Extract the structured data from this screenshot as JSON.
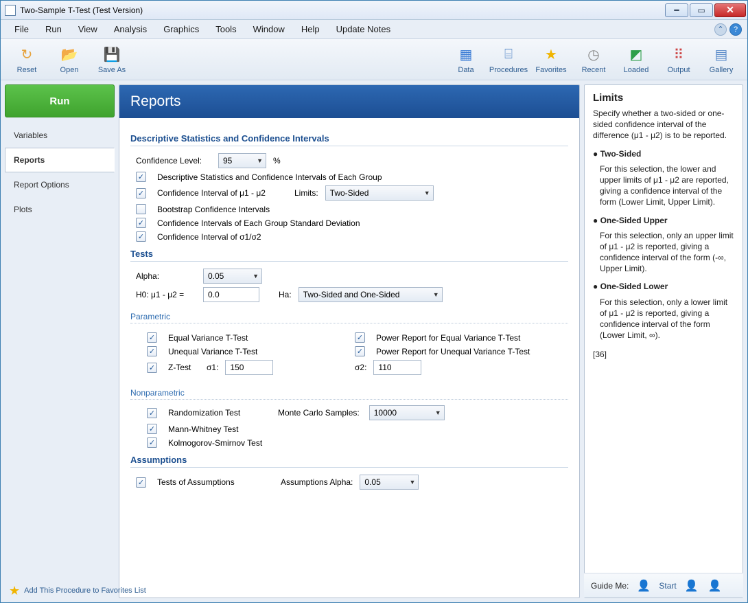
{
  "window": {
    "title": "Two-Sample T-Test (Test Version)"
  },
  "menubar": [
    "File",
    "Run",
    "View",
    "Analysis",
    "Graphics",
    "Tools",
    "Window",
    "Help",
    "Update Notes"
  ],
  "toolbar_left": [
    {
      "label": "Reset",
      "glyph": "↻",
      "color": "#e6a23c"
    },
    {
      "label": "Open",
      "glyph": "📂",
      "color": "#e6a23c"
    },
    {
      "label": "Save As",
      "glyph": "💾",
      "color": "#5b8bc9"
    }
  ],
  "toolbar_right": [
    {
      "label": "Data",
      "glyph": "▦",
      "color": "#3a7bd5"
    },
    {
      "label": "Procedures",
      "glyph": "⌸",
      "color": "#5b8bc9"
    },
    {
      "label": "Favorites",
      "glyph": "★",
      "color": "#f0b400"
    },
    {
      "label": "Recent",
      "glyph": "◷",
      "color": "#888"
    },
    {
      "label": "Loaded",
      "glyph": "◩",
      "color": "#2e9e4a"
    },
    {
      "label": "Output",
      "glyph": "⠿",
      "color": "#c44"
    },
    {
      "label": "Gallery",
      "glyph": "▤",
      "color": "#5b8bc9"
    }
  ],
  "run_label": "Run",
  "navtabs": [
    "Variables",
    "Reports",
    "Report Options",
    "Plots"
  ],
  "active_nav": 1,
  "banner": "Reports",
  "sections": {
    "descriptive_title": "Descriptive Statistics and Confidence Intervals",
    "tests_title": "Tests",
    "parametric_title": "Parametric",
    "nonparametric_title": "Nonparametric",
    "assumptions_title": "Assumptions"
  },
  "fields": {
    "confidence_level_label": "Confidence Level:",
    "confidence_level_value": "95",
    "confidence_level_suffix": "%",
    "chk_desc_stats": "Descriptive Statistics and Confidence Intervals of Each Group",
    "chk_ci_mu": "Confidence Interval of μ1 - μ2",
    "limits_label": "Limits:",
    "limits_value": "Two-Sided",
    "chk_bootstrap": "Bootstrap Confidence Intervals",
    "chk_ci_group_sd": "Confidence Intervals of Each Group Standard Deviation",
    "chk_ci_sigma_ratio": "Confidence Interval of σ1/σ2",
    "alpha_label": "Alpha:",
    "alpha_value": "0.05",
    "h0_label": "H0: μ1 - μ2 =",
    "h0_value": "0.0",
    "ha_label": "Ha:",
    "ha_value": "Two-Sided and One-Sided",
    "chk_eqvar": "Equal Variance T-Test",
    "chk_uneqvar": "Unequal Variance T-Test",
    "chk_ztest": "Z-Test",
    "sigma1_label": "σ1:",
    "sigma1_value": "150",
    "sigma2_label": "σ2:",
    "sigma2_value": "110",
    "chk_power_eq": "Power Report for Equal Variance T-Test",
    "chk_power_uneq": "Power Report for Unequal Variance T-Test",
    "chk_randomization": "Randomization Test",
    "mc_label": "Monte Carlo Samples:",
    "mc_value": "10000",
    "chk_mannwhitney": "Mann-Whitney Test",
    "chk_ks": "Kolmogorov-Smirnov Test",
    "chk_assumptions": "Tests of Assumptions",
    "assumptions_alpha_label": "Assumptions Alpha:",
    "assumptions_alpha_value": "0.05"
  },
  "help": {
    "title": "Limits",
    "intro": "Specify whether a two-sided or one-sided confidence interval of the difference (μ1 - μ2) is to be reported.",
    "b1": "● Two-Sided",
    "d1": "For this selection, the lower and upper limits of μ1 - μ2 are reported, giving a confidence interval of the form (Lower Limit, Upper Limit).",
    "b2": "● One-Sided Upper",
    "d2": "For this selection, only an upper limit of μ1 - μ2 is reported, giving a confidence interval of the form (-∞, Upper Limit).",
    "b3": "● One-Sided Lower",
    "d3": "For this selection, only a lower limit of μ1 - μ2 is reported, giving a confidence interval of the form (Lower Limit, ∞).",
    "ref": "[36]"
  },
  "guide": {
    "label": "Guide Me:",
    "start": "Start"
  },
  "favorites_note": "Add This Procedure to Favorites List"
}
